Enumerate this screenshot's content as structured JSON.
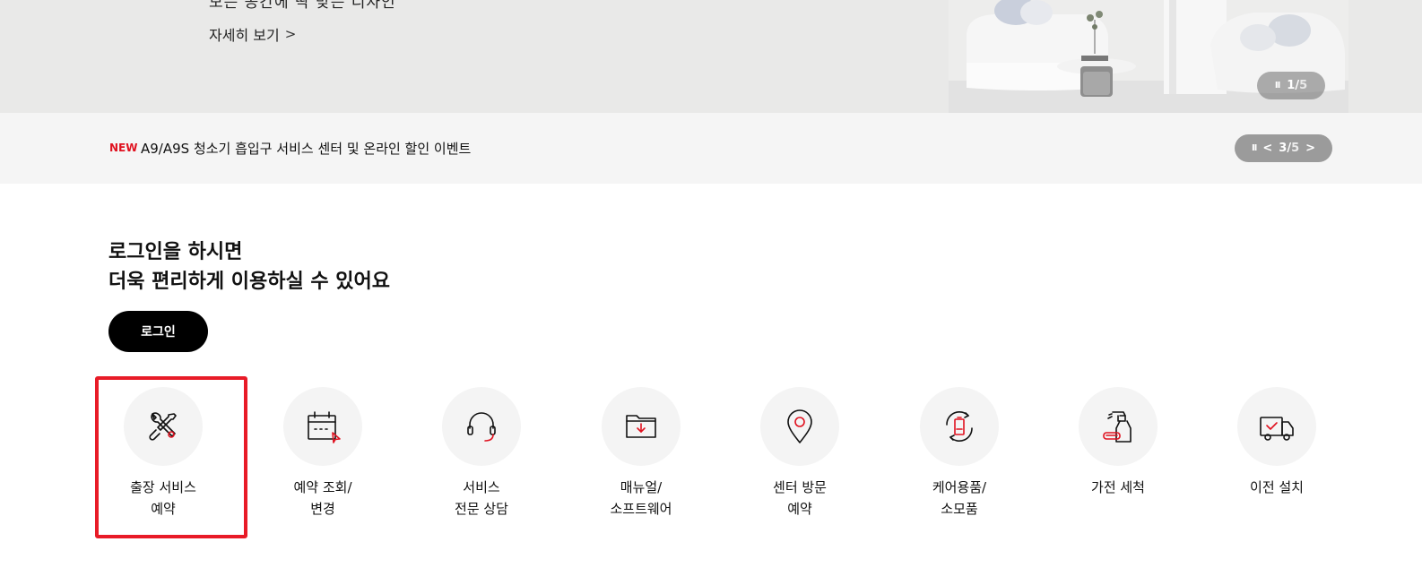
{
  "hero": {
    "cut_text": "모든 공간에 딱 맞는 디자인",
    "detail_label": "자세히 보기",
    "detail_chevron": ">",
    "counter_current": "1",
    "counter_sep": "/",
    "counter_total": "5",
    "pause_glyph": "II"
  },
  "notice": {
    "badge": "NEW",
    "text": "A9/A9S 청소기 흡입구 서비스 센터 및 온라인 할인 이벤트",
    "pause_glyph": "II",
    "prev_glyph": "<",
    "next_glyph": ">",
    "current": "3",
    "sep": "/",
    "total": "5"
  },
  "login": {
    "title_line1": "로그인을 하시면",
    "title_line2": "더욱 편리하게 이용하실 수 있어요",
    "button_label": "로그인"
  },
  "quick_menu": [
    {
      "label": "출장 서비스\n예약",
      "icon": "tools-icon"
    },
    {
      "label": "예약 조회/\n변경",
      "icon": "calendar-icon"
    },
    {
      "label": "서비스\n전문 상담",
      "icon": "headset-icon"
    },
    {
      "label": "매뉴얼/\n소프트웨어",
      "icon": "folder-download-icon"
    },
    {
      "label": "센터 방문\n예약",
      "icon": "location-pin-icon"
    },
    {
      "label": "케어용품/\n소모품",
      "icon": "battery-cycle-icon"
    },
    {
      "label": "가전 세척",
      "icon": "spray-bottle-icon"
    },
    {
      "label": "이전 설치",
      "icon": "delivery-truck-icon"
    }
  ],
  "colors": {
    "accent_red": "#e0111f",
    "highlight_red": "#e81b27",
    "button_black": "#000000"
  }
}
